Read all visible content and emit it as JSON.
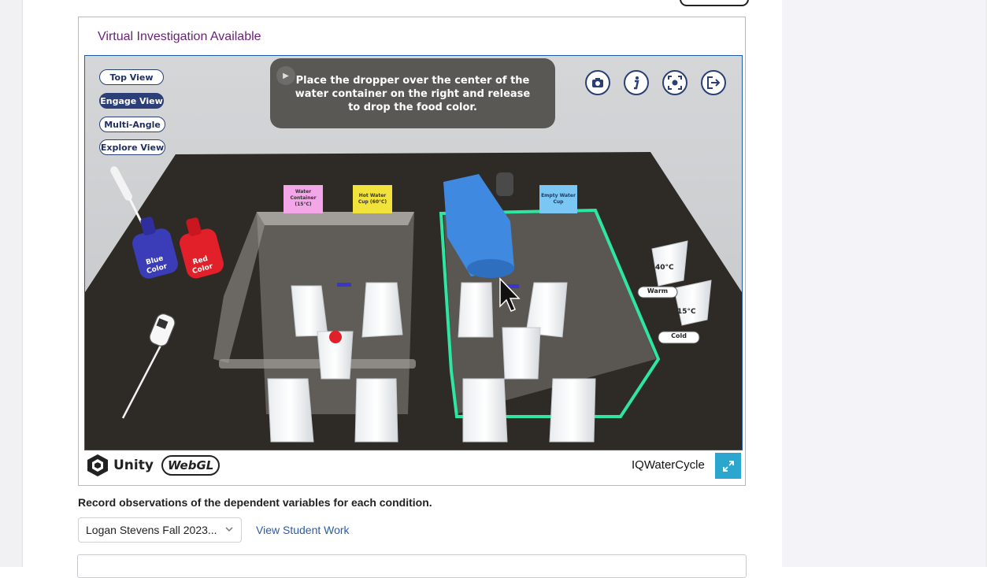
{
  "card": {
    "title": "Virtual Investigation Available"
  },
  "views": [
    {
      "label": "Top View",
      "active": false
    },
    {
      "label": "Engage View",
      "active": true
    },
    {
      "label": "Multi-Angle",
      "active": false
    },
    {
      "label": "Explore View",
      "active": false
    }
  ],
  "instruction": {
    "text": "Place the dropper over the center of the water container on the right and release to drop the food color."
  },
  "tools": [
    {
      "name": "camera-icon"
    },
    {
      "name": "info-icon"
    },
    {
      "name": "screenshot-icon"
    },
    {
      "name": "exit-icon"
    }
  ],
  "scene": {
    "labels": {
      "water_container": "Water Container (15°C)",
      "hot_water_cup": "Hot Water Cup (60°C)",
      "empty_water_cup": "Empty Water Cup",
      "blue_color": "Blue Color",
      "red_color": "Red Color",
      "temp_40": "40°C",
      "temp_15": "15°C",
      "warm": "Warm",
      "cold": "Cold"
    }
  },
  "footer": {
    "unity": "Unity",
    "webgl": "WebGL",
    "app_name": "IQWaterCycle"
  },
  "prompt": "Record observations of the dependent variables for each condition.",
  "student_select": {
    "value": "Logan Stevens Fall 2023..."
  },
  "view_student_work": "View Student Work",
  "colors": {
    "title": "#6b1f7a",
    "link": "#2a5ca8",
    "highlight": "#2ee6a0",
    "fullscreen": "#2ba6cf"
  }
}
